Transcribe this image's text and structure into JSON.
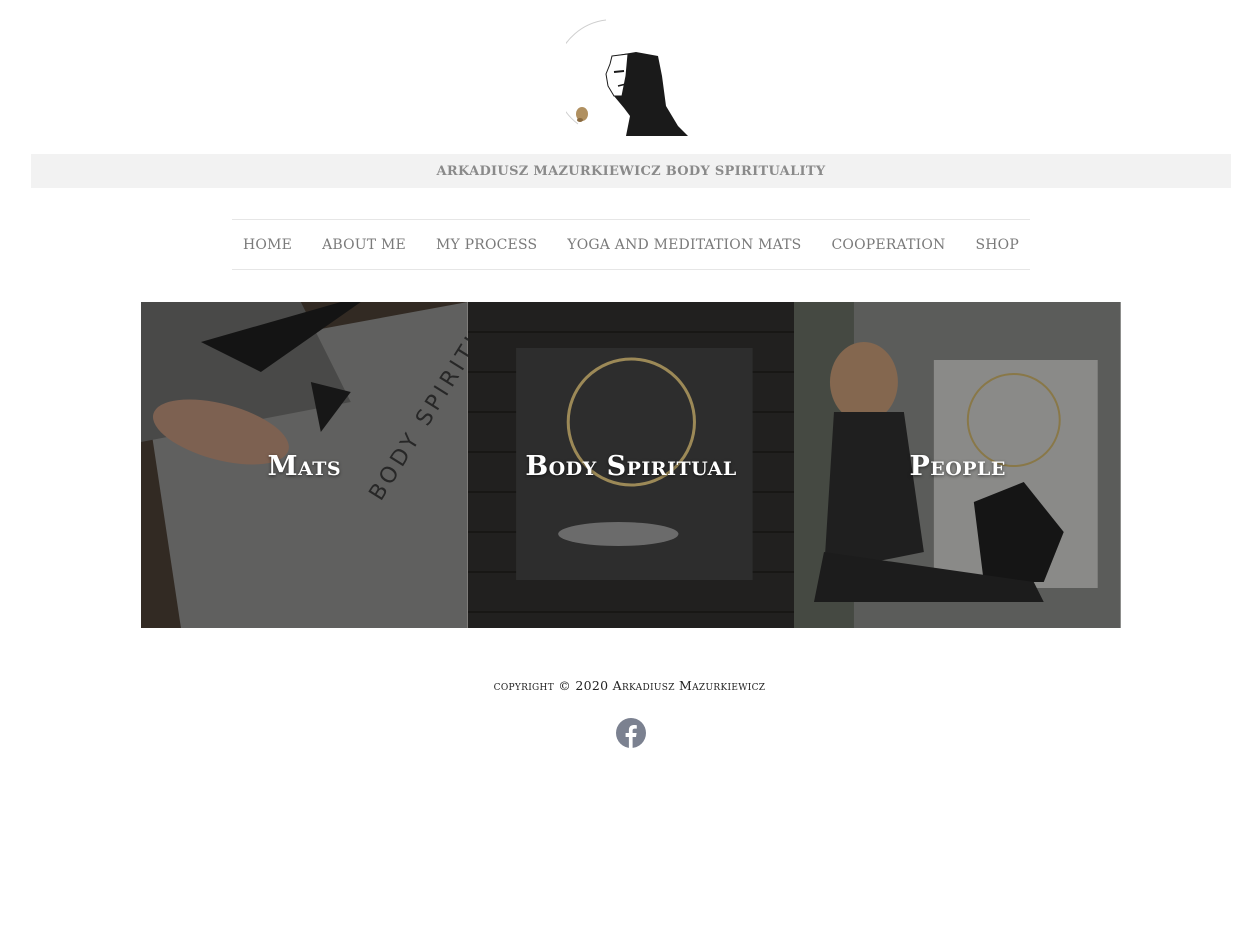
{
  "site": {
    "tagline": "ARKADIUSZ MAZURKIEWICZ BODY SPIRITUALITY"
  },
  "nav": {
    "items": [
      {
        "label": "HOME"
      },
      {
        "label": "ABOUT ME"
      },
      {
        "label": "MY PROCESS"
      },
      {
        "label": "YOGA AND MEDITATION MATS"
      },
      {
        "label": "COOPERATION"
      },
      {
        "label": "SHOP"
      }
    ]
  },
  "tiles": [
    {
      "title": "Mats"
    },
    {
      "title": "Body Spiritual"
    },
    {
      "title": "People"
    }
  ],
  "footer": {
    "copyright": "copyright © 2020 Arkadiusz Mazurkiewicz",
    "social_icon": "facebook-icon"
  },
  "colors": {
    "tagline_bar": "#f2f2f2",
    "nav_text": "#7a7a7a",
    "facebook_icon": "#7b8190"
  }
}
